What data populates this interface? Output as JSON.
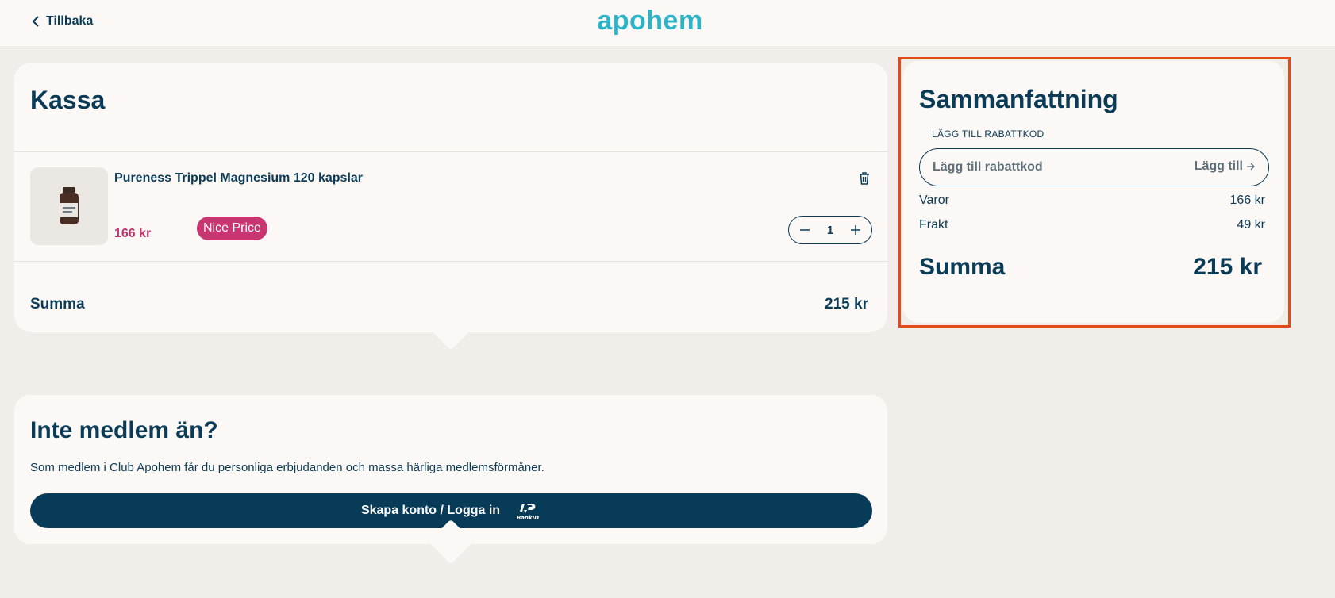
{
  "header": {
    "back_label": "Tillbaka",
    "logo_text": "apohem"
  },
  "checkout": {
    "title": "Kassa",
    "item": {
      "name": "Pureness Trippel Magnesium 120 kapslar",
      "price": "166 kr",
      "badge": "Nice Price",
      "quantity": "1"
    },
    "sum_label": "Summa",
    "sum_value": "215 kr"
  },
  "member": {
    "title": "Inte medlem än?",
    "text": "Som medlem i Club Apohem får du personliga erbjudanden och massa härliga medlemsförmåner.",
    "button_label": "Skapa konto / Logga in",
    "bankid_label": "BankID"
  },
  "summary": {
    "title": "Sammanfattning",
    "discount_label": "LÄGG TILL RABATTKOD",
    "discount_placeholder": "Lägg till rabattkod",
    "discount_button": "Lägg till",
    "rows": [
      {
        "label": "Varor",
        "value": "166 kr"
      },
      {
        "label": "Frakt",
        "value": "49 kr"
      }
    ],
    "total_label": "Summa",
    "total_value": "215 kr"
  },
  "colors": {
    "brand": "#2bb3c7",
    "primary": "#0a3b57",
    "price": "#c2366f",
    "badge": "#c73670",
    "highlight": "#e24a1a"
  }
}
